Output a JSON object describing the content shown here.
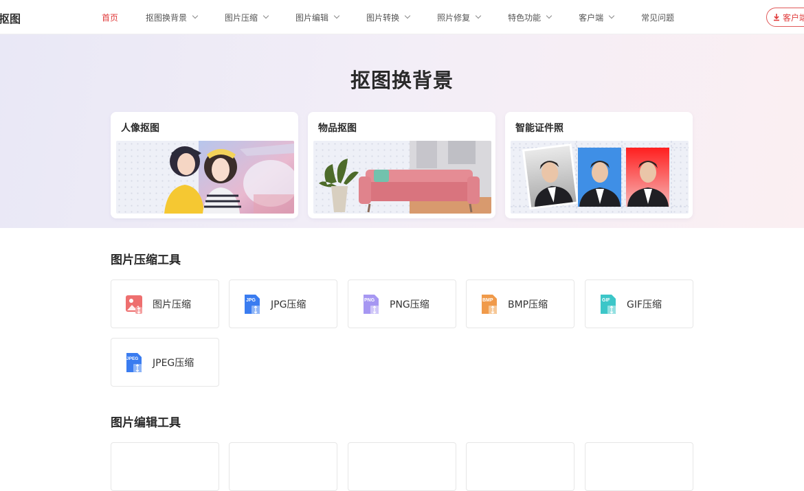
{
  "header": {
    "logo": "抠图",
    "nav": [
      {
        "label": "首页",
        "active": true,
        "dropdown": false,
        "name": "nav-home"
      },
      {
        "label": "抠图换背景",
        "active": false,
        "dropdown": true,
        "name": "nav-cutout"
      },
      {
        "label": "图片压缩",
        "active": false,
        "dropdown": true,
        "name": "nav-compress"
      },
      {
        "label": "图片编辑",
        "active": false,
        "dropdown": true,
        "name": "nav-edit"
      },
      {
        "label": "图片转换",
        "active": false,
        "dropdown": true,
        "name": "nav-convert"
      },
      {
        "label": "照片修复",
        "active": false,
        "dropdown": true,
        "name": "nav-repair"
      },
      {
        "label": "特色功能",
        "active": false,
        "dropdown": true,
        "name": "nav-features"
      },
      {
        "label": "客户端",
        "active": false,
        "dropdown": true,
        "name": "nav-client"
      },
      {
        "label": "常见问题",
        "active": false,
        "dropdown": false,
        "name": "nav-faq"
      }
    ],
    "client_button": "客户端"
  },
  "hero": {
    "title": "抠图换背景",
    "cards": [
      {
        "label": "人像抠图",
        "name": "portrait-cutout-card"
      },
      {
        "label": "物品抠图",
        "name": "object-cutout-card"
      },
      {
        "label": "智能证件照",
        "name": "id-photo-card"
      }
    ]
  },
  "compress_section": {
    "title": "图片压缩工具",
    "tools": [
      {
        "label": "图片压缩",
        "badge": "",
        "color": "#ee6f6f",
        "icon": "image-compress-icon"
      },
      {
        "label": "JPG压缩",
        "badge": "JPG",
        "color": "#3a7cf0",
        "icon": "jpg-icon"
      },
      {
        "label": "PNG压缩",
        "badge": "PNG",
        "color": "#9f8ff0",
        "icon": "png-icon"
      },
      {
        "label": "BMP压缩",
        "badge": "BMP",
        "color": "#f09a4a",
        "icon": "bmp-icon"
      },
      {
        "label": "GIF压缩",
        "badge": "GIF",
        "color": "#3cc6c8",
        "icon": "gif-icon"
      },
      {
        "label": "JPEG压缩",
        "badge": "JPEG",
        "color": "#3a7cf0",
        "icon": "jpeg-icon"
      }
    ]
  },
  "edit_section": {
    "title": "图片编辑工具"
  },
  "colors": {
    "accent": "#e03a3a"
  }
}
